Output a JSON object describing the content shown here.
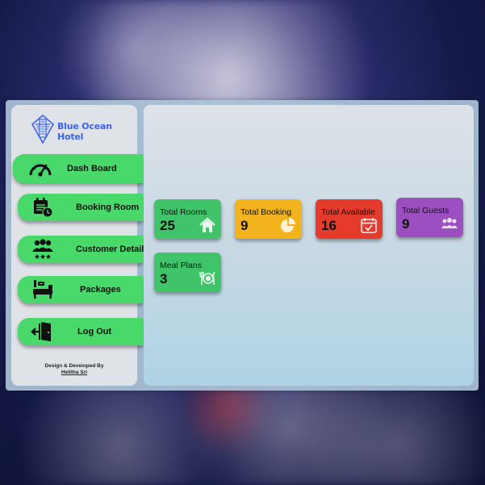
{
  "brand": {
    "name": "Blue Ocean Hotel",
    "logo_icon": "hotel-building-logo"
  },
  "sidebar": {
    "items": [
      {
        "label": "Dash Board",
        "icon": "speedometer-icon"
      },
      {
        "label": "Booking Room",
        "icon": "calendar-clock-icon"
      },
      {
        "label": "Customer Details",
        "icon": "people-stars-icon"
      },
      {
        "label": "Packages",
        "icon": "bed-icon"
      },
      {
        "label": "Log Out",
        "icon": "exit-door-icon"
      }
    ],
    "credit_line": "Design & Developed By",
    "credit_author": "Helitha Sri"
  },
  "dashboard": {
    "cards": [
      {
        "title": "Total Rooms",
        "value": "25",
        "icon": "home-icon",
        "color": "#3fc46a"
      },
      {
        "title": "Total Booking",
        "value": "9",
        "icon": "pie-chart-icon",
        "color": "#f2b31c"
      },
      {
        "title": "Total Available",
        "value": "16",
        "icon": "calendar-check-icon",
        "color": "#e43b2c"
      },
      {
        "title": "Total Guests",
        "value": "9",
        "icon": "users-icon",
        "color": "#9b4fc0"
      },
      {
        "title": "Meal Plans",
        "value": "3",
        "icon": "dining-icon",
        "color": "#3fc46a"
      }
    ]
  },
  "colors": {
    "accent_green": "#49d96b",
    "brand_blue": "#3d63e8"
  }
}
